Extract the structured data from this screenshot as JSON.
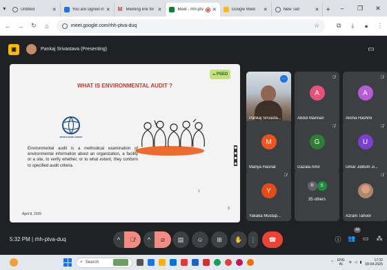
{
  "browser": {
    "tabs": [
      {
        "label": "Untitled",
        "favicon": "globe-icon",
        "color": "#5f6368"
      },
      {
        "label": "You are signed in",
        "favicon": "document-icon",
        "color": "#1a73e8"
      },
      {
        "label": "Meeting link for",
        "favicon": "gmail-icon",
        "color": "#d93025"
      },
      {
        "label": "Meet - rhh-ptv",
        "favicon": "meet-icon",
        "color": "#00832d",
        "active": true
      },
      {
        "label": "Google Meet",
        "favicon": "meet-icon",
        "color": "#fbbc04"
      },
      {
        "label": "New Tab",
        "favicon": "chrome-icon",
        "color": "#5f6368"
      }
    ],
    "new_tab": "+",
    "window_controls": {
      "minimize": "–",
      "maximize": "❐",
      "close": "✕"
    },
    "url": "meet.google.com/rhh-ptva-duq"
  },
  "meet": {
    "presenter": "Pankaj Srivastava (Presenting)",
    "slide": {
      "brand": "PSED",
      "title": "WHAT IS ENVIRONMENTAL AUDIT ?",
      "logo_label": "WORLD BANK GROUP",
      "body": "Environmental audit is a methodical examination of environmental information about an organization, a facility or a site, to verify whether, or to what extent, they conform to specified audit criteria.",
      "date": "April 8, 2025",
      "page": "3",
      "mark": "1"
    },
    "tiles": [
      {
        "name": "Pankaj Srivasta...",
        "self": true
      },
      {
        "name": "Abdul Mannan",
        "initial": "A",
        "color": "#e8517a"
      },
      {
        "name": "Alisha Hashmi",
        "initial": "A",
        "color": "#b85bd6"
      },
      {
        "name": "Mariya Hasnat",
        "initial": "M",
        "color": "#f4511e"
      },
      {
        "name": "Gazala Amir",
        "initial": "G",
        "color": "#2e7d32"
      },
      {
        "name": "Umar Jiddum Ji...",
        "initial": "U",
        "color": "#7b3fd1"
      },
      {
        "name": "Yakaka Mustap...",
        "initial": "Y",
        "color": "#e64a19"
      },
      {
        "name": "35 others",
        "group": [
          "R",
          "S"
        ],
        "group_colors": [
          "#5f6368",
          "#1e8e3e"
        ]
      },
      {
        "name": "Azram Tahoor",
        "photo": true
      }
    ],
    "time": "5:32 PM",
    "separator": "|",
    "meeting_code": "rhh-ptva-duq",
    "participant_count": "44"
  },
  "taskbar": {
    "search_placeholder": "Search",
    "lang": "ENG",
    "region": "IN",
    "time": "17:32",
    "date": "08-04-2025"
  }
}
